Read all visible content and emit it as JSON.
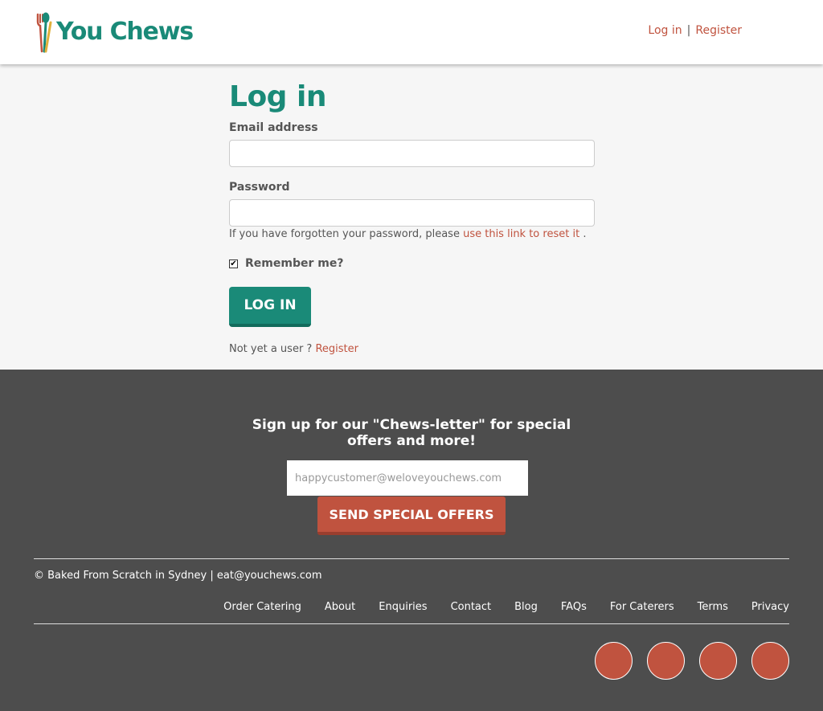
{
  "header": {
    "brand": "You Chews",
    "nav": {
      "login": "Log in",
      "separator": "|",
      "register": "Register"
    }
  },
  "login": {
    "title": "Log in",
    "email_label": "Email address",
    "email_value": "",
    "password_label": "Password",
    "password_value": "",
    "forgot_prefix": "If you have forgotten your password, please",
    "forgot_link": "use this link to reset it",
    "forgot_suffix": ".",
    "remember_label": "Remember me?",
    "remember_mark": "✔",
    "button": "LOG IN",
    "not_user_prefix": "Not yet a user ?",
    "not_user_link": "Register"
  },
  "footer": {
    "newsletter_title": "Sign up for our \"Chews-letter\" for special offers and more!",
    "newsletter_placeholder": "happycustomer@weloveyouchews.com",
    "newsletter_button": "SEND SPECIAL OFFERS",
    "copyright": "© Baked From Scratch in Sydney | eat@youchews.com",
    "nav": [
      "Order Catering",
      "About",
      "Enquiries",
      "Contact",
      "Blog",
      "FAQs",
      "For Caterers",
      "Terms",
      "Privacy"
    ]
  },
  "colors": {
    "brand_green": "#1a8a78",
    "accent_red": "#c0533f",
    "footer_bg": "#4d4d4d"
  }
}
